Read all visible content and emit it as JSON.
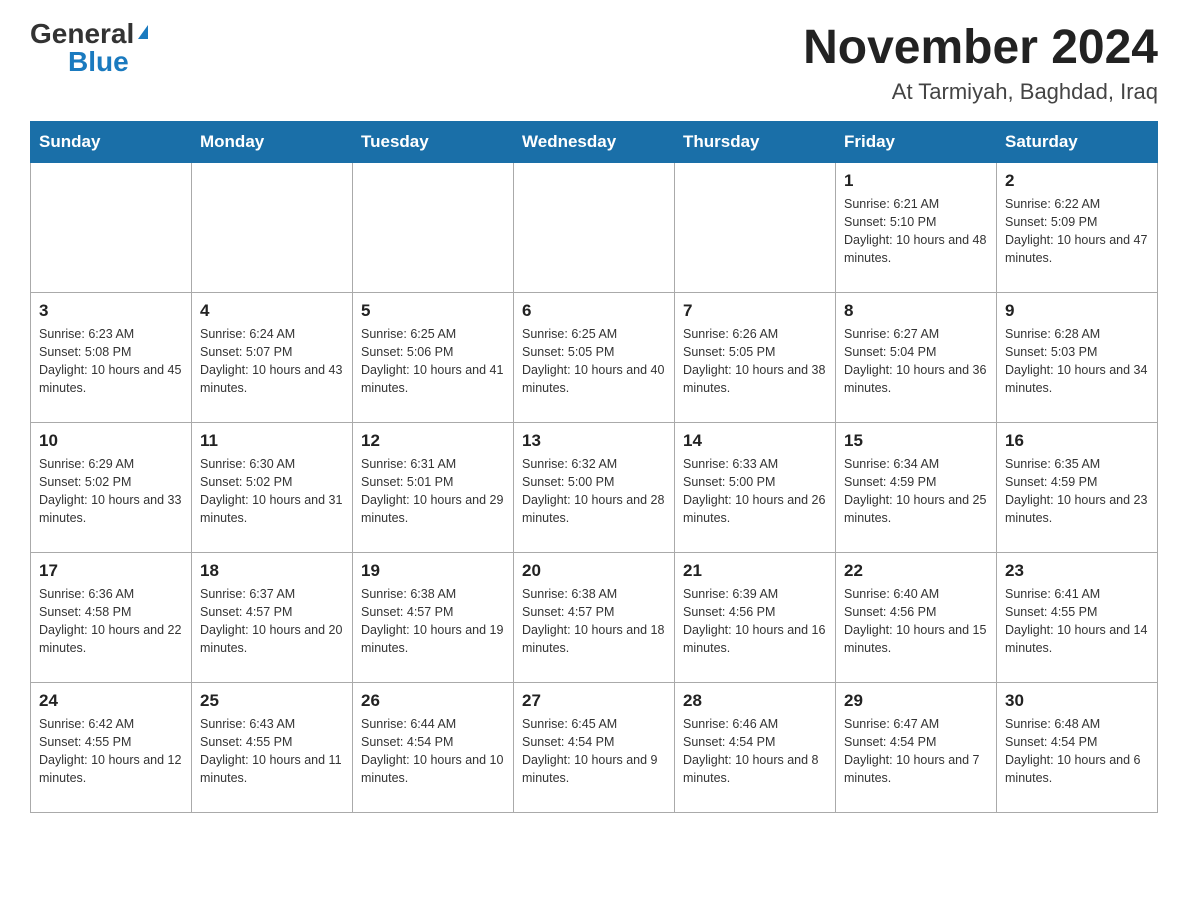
{
  "header": {
    "logo_general": "General",
    "logo_blue": "Blue",
    "main_title": "November 2024",
    "subtitle": "At Tarmiyah, Baghdad, Iraq"
  },
  "calendar": {
    "days_of_week": [
      "Sunday",
      "Monday",
      "Tuesday",
      "Wednesday",
      "Thursday",
      "Friday",
      "Saturday"
    ],
    "weeks": [
      [
        {
          "day": "",
          "info": ""
        },
        {
          "day": "",
          "info": ""
        },
        {
          "day": "",
          "info": ""
        },
        {
          "day": "",
          "info": ""
        },
        {
          "day": "",
          "info": ""
        },
        {
          "day": "1",
          "info": "Sunrise: 6:21 AM\nSunset: 5:10 PM\nDaylight: 10 hours and 48 minutes."
        },
        {
          "day": "2",
          "info": "Sunrise: 6:22 AM\nSunset: 5:09 PM\nDaylight: 10 hours and 47 minutes."
        }
      ],
      [
        {
          "day": "3",
          "info": "Sunrise: 6:23 AM\nSunset: 5:08 PM\nDaylight: 10 hours and 45 minutes."
        },
        {
          "day": "4",
          "info": "Sunrise: 6:24 AM\nSunset: 5:07 PM\nDaylight: 10 hours and 43 minutes."
        },
        {
          "day": "5",
          "info": "Sunrise: 6:25 AM\nSunset: 5:06 PM\nDaylight: 10 hours and 41 minutes."
        },
        {
          "day": "6",
          "info": "Sunrise: 6:25 AM\nSunset: 5:05 PM\nDaylight: 10 hours and 40 minutes."
        },
        {
          "day": "7",
          "info": "Sunrise: 6:26 AM\nSunset: 5:05 PM\nDaylight: 10 hours and 38 minutes."
        },
        {
          "day": "8",
          "info": "Sunrise: 6:27 AM\nSunset: 5:04 PM\nDaylight: 10 hours and 36 minutes."
        },
        {
          "day": "9",
          "info": "Sunrise: 6:28 AM\nSunset: 5:03 PM\nDaylight: 10 hours and 34 minutes."
        }
      ],
      [
        {
          "day": "10",
          "info": "Sunrise: 6:29 AM\nSunset: 5:02 PM\nDaylight: 10 hours and 33 minutes."
        },
        {
          "day": "11",
          "info": "Sunrise: 6:30 AM\nSunset: 5:02 PM\nDaylight: 10 hours and 31 minutes."
        },
        {
          "day": "12",
          "info": "Sunrise: 6:31 AM\nSunset: 5:01 PM\nDaylight: 10 hours and 29 minutes."
        },
        {
          "day": "13",
          "info": "Sunrise: 6:32 AM\nSunset: 5:00 PM\nDaylight: 10 hours and 28 minutes."
        },
        {
          "day": "14",
          "info": "Sunrise: 6:33 AM\nSunset: 5:00 PM\nDaylight: 10 hours and 26 minutes."
        },
        {
          "day": "15",
          "info": "Sunrise: 6:34 AM\nSunset: 4:59 PM\nDaylight: 10 hours and 25 minutes."
        },
        {
          "day": "16",
          "info": "Sunrise: 6:35 AM\nSunset: 4:59 PM\nDaylight: 10 hours and 23 minutes."
        }
      ],
      [
        {
          "day": "17",
          "info": "Sunrise: 6:36 AM\nSunset: 4:58 PM\nDaylight: 10 hours and 22 minutes."
        },
        {
          "day": "18",
          "info": "Sunrise: 6:37 AM\nSunset: 4:57 PM\nDaylight: 10 hours and 20 minutes."
        },
        {
          "day": "19",
          "info": "Sunrise: 6:38 AM\nSunset: 4:57 PM\nDaylight: 10 hours and 19 minutes."
        },
        {
          "day": "20",
          "info": "Sunrise: 6:38 AM\nSunset: 4:57 PM\nDaylight: 10 hours and 18 minutes."
        },
        {
          "day": "21",
          "info": "Sunrise: 6:39 AM\nSunset: 4:56 PM\nDaylight: 10 hours and 16 minutes."
        },
        {
          "day": "22",
          "info": "Sunrise: 6:40 AM\nSunset: 4:56 PM\nDaylight: 10 hours and 15 minutes."
        },
        {
          "day": "23",
          "info": "Sunrise: 6:41 AM\nSunset: 4:55 PM\nDaylight: 10 hours and 14 minutes."
        }
      ],
      [
        {
          "day": "24",
          "info": "Sunrise: 6:42 AM\nSunset: 4:55 PM\nDaylight: 10 hours and 12 minutes."
        },
        {
          "day": "25",
          "info": "Sunrise: 6:43 AM\nSunset: 4:55 PM\nDaylight: 10 hours and 11 minutes."
        },
        {
          "day": "26",
          "info": "Sunrise: 6:44 AM\nSunset: 4:54 PM\nDaylight: 10 hours and 10 minutes."
        },
        {
          "day": "27",
          "info": "Sunrise: 6:45 AM\nSunset: 4:54 PM\nDaylight: 10 hours and 9 minutes."
        },
        {
          "day": "28",
          "info": "Sunrise: 6:46 AM\nSunset: 4:54 PM\nDaylight: 10 hours and 8 minutes."
        },
        {
          "day": "29",
          "info": "Sunrise: 6:47 AM\nSunset: 4:54 PM\nDaylight: 10 hours and 7 minutes."
        },
        {
          "day": "30",
          "info": "Sunrise: 6:48 AM\nSunset: 4:54 PM\nDaylight: 10 hours and 6 minutes."
        }
      ]
    ]
  }
}
